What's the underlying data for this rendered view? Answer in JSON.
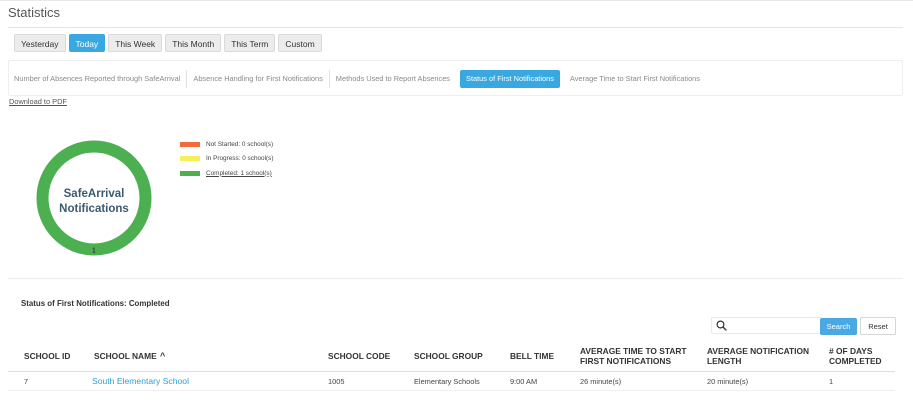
{
  "page": {
    "title": "Statistics"
  },
  "period_filters": [
    {
      "label": "Yesterday",
      "active": false
    },
    {
      "label": "Today",
      "active": true
    },
    {
      "label": "This Week",
      "active": false
    },
    {
      "label": "This Month",
      "active": false
    },
    {
      "label": "This Term",
      "active": false
    },
    {
      "label": "Custom",
      "active": false
    }
  ],
  "report_tabs": [
    {
      "label": "Number of Absences Reported through SafeArrival",
      "active": false
    },
    {
      "label": "Absence Handling for First Notifications",
      "active": false
    },
    {
      "label": "Methods Used to Report Absences",
      "active": false
    },
    {
      "label": "Status of First Notifications",
      "active": true
    },
    {
      "label": "Average Time to Start First Notifications",
      "active": false
    }
  ],
  "download_link": "Download to PDF",
  "chart_data": {
    "type": "pie",
    "center_label_line1": "SafeArrival",
    "center_label_line2": "Notifications",
    "categories": [
      "Not Started",
      "In Progress",
      "Completed"
    ],
    "values": [
      0,
      0,
      1
    ],
    "colors": [
      "#f26b3a",
      "#f5ef5b",
      "#4caf50"
    ],
    "data_label": "1",
    "legend_labels": [
      "Not Started: 0 school(s)",
      "In Progress: 0 school(s)",
      "Completed: 1 school(s)"
    ],
    "legend_position": "right"
  },
  "table": {
    "title": "Status of First Notifications: Completed",
    "search_placeholder": "",
    "search_button": "Search",
    "reset_button": "Reset",
    "sort_indicator": "^",
    "columns": [
      "SCHOOL ID",
      "SCHOOL NAME",
      "SCHOOL CODE",
      "SCHOOL GROUP",
      "BELL TIME",
      "AVERAGE TIME TO START FIRST NOTIFICATIONS",
      "AVERAGE NOTIFICATION LENGTH",
      "# OF DAYS COMPLETED"
    ],
    "columns_line1": [
      "SCHOOL ID",
      "SCHOOL NAME",
      "SCHOOL CODE",
      "SCHOOL GROUP",
      "BELL TIME",
      "AVERAGE TIME TO START",
      "AVERAGE NOTIFICATION",
      "# OF DAYS"
    ],
    "columns_line2": [
      "",
      "",
      "",
      "",
      "",
      "FIRST NOTIFICATIONS",
      "LENGTH",
      "COMPLETED"
    ],
    "rows": [
      [
        "7",
        "South Elementary School",
        "1005",
        "Elementary Schools",
        "9:00 AM",
        "26 minute(s)",
        "20 minute(s)",
        "1"
      ]
    ]
  },
  "colors": {
    "accent": "#3aa8e0",
    "link": "#2a9fd8",
    "donut": "#4caf50"
  }
}
